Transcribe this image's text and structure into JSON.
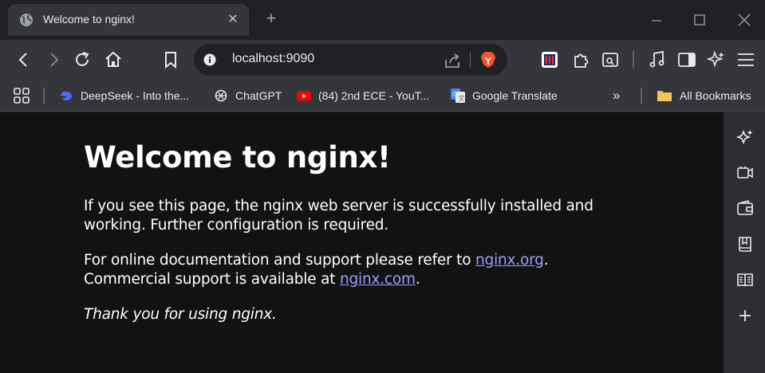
{
  "tab": {
    "title": "Welcome to nginx!",
    "close": "✕"
  },
  "new_tab": "+",
  "omnibox": {
    "url": "localhost:9090"
  },
  "bookmarks": [
    {
      "label": "DeepSeek - Into the...",
      "icon": "deepseek-icon"
    },
    {
      "label": "ChatGPT",
      "icon": "chatgpt-icon"
    },
    {
      "label": "(84) 2nd ECE - YouT...",
      "icon": "youtube-icon"
    },
    {
      "label": "Google Translate",
      "icon": "google-translate-icon"
    }
  ],
  "more_bookmarks": "»",
  "all_bookmarks": "All Bookmarks",
  "page": {
    "heading": "Welcome to nginx!",
    "p1_line1": "If you see this page, the nginx web server is successfully installed and",
    "p1_line2": "working. Further configuration is required.",
    "p2_line1_pre": "For online documentation and support please refer to ",
    "p2_link1": "nginx.org",
    "p2_line1_post": ".",
    "p2_line2_pre": "Commercial support is available at ",
    "p2_link2": "nginx.com",
    "p2_line2_post": ".",
    "p3": "Thank you for using nginx."
  },
  "colors": {
    "link": "#9e9eff",
    "brave": "#fb542b",
    "youtube": "#ff0000",
    "folder": "#f2b84b"
  }
}
